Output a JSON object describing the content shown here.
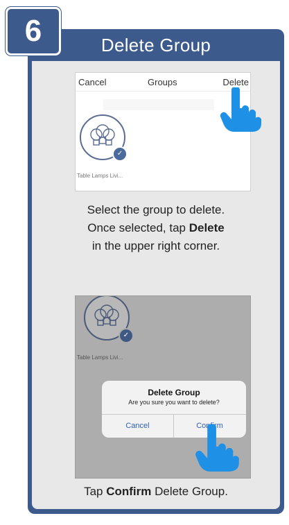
{
  "step": {
    "number": "6"
  },
  "header": {
    "title": "Delete Group"
  },
  "screen1": {
    "nav": {
      "cancel": "Cancel",
      "title": "Groups",
      "delete": "Delete"
    },
    "group": {
      "label": "Table Lamps Livi..."
    }
  },
  "caption1": {
    "line1": "Select the group to delete.",
    "line2_prefix": "Once selected, tap ",
    "line2_bold": "Delete",
    "line3": "in the upper right corner."
  },
  "screen2": {
    "group": {
      "label": "Table Lamps Livi..."
    },
    "dialog": {
      "title": "Delete Group",
      "message": "Are you sure you want to delete?",
      "cancel": "Cancel",
      "confirm": "Confirm"
    }
  },
  "caption2": {
    "prefix": "Tap ",
    "bold": "Confirm",
    "suffix": " Delete Group."
  },
  "colors": {
    "brand": "#3d5a8c",
    "accent": "#4d6a9c",
    "link": "#2f5fb3",
    "hand": "#1e90e6"
  }
}
